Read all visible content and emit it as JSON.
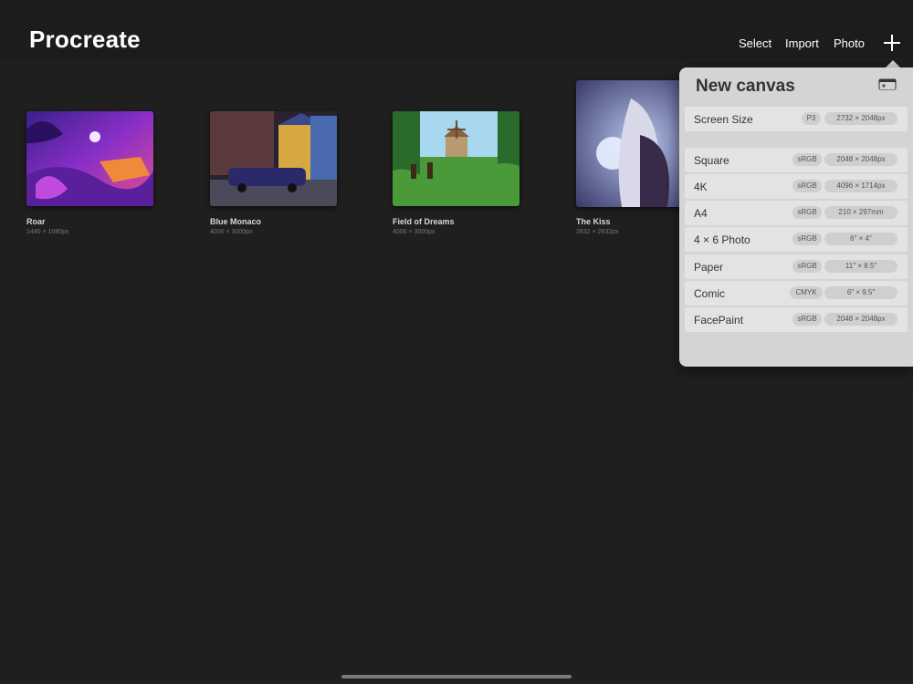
{
  "header": {
    "title": "Procreate",
    "select_label": "Select",
    "import_label": "Import",
    "photo_label": "Photo",
    "add_icon": "plus-icon"
  },
  "gallery": [
    {
      "title": "Roar",
      "size": "1440 × 1080px"
    },
    {
      "title": "Blue Monaco",
      "size": "4000 × 3000px"
    },
    {
      "title": "Field of Dreams",
      "size": "4000 × 3000px"
    },
    {
      "title": "The Kiss",
      "size": "2632 × 2632px"
    }
  ],
  "new_canvas": {
    "title": "New canvas",
    "custom_icon": "add-canvas-icon",
    "screen_size": {
      "label": "Screen Size",
      "color_space": "P3",
      "dimensions": "2732 × 2048px"
    },
    "presets": [
      {
        "label": "Square",
        "color_space": "sRGB",
        "dimensions": "2048 × 2048px"
      },
      {
        "label": "4K",
        "color_space": "sRGB",
        "dimensions": "4096 × 1714px"
      },
      {
        "label": "A4",
        "color_space": "sRGB",
        "dimensions": "210 × 297mm"
      },
      {
        "label": "4 × 6 Photo",
        "color_space": "sRGB",
        "dimensions": "6″ × 4″"
      },
      {
        "label": "Paper",
        "color_space": "sRGB",
        "dimensions": "11″ × 8.5″"
      },
      {
        "label": "Comic",
        "color_space": "CMYK",
        "dimensions": "6″ × 9.5″"
      },
      {
        "label": "FacePaint",
        "color_space": "sRGB",
        "dimensions": "2048 × 2048px"
      }
    ]
  },
  "colors": {
    "background": "#1f1f1f",
    "popover": "#d4d4d4",
    "row": "#e3e3e3",
    "pill": "#cfcfcf"
  }
}
